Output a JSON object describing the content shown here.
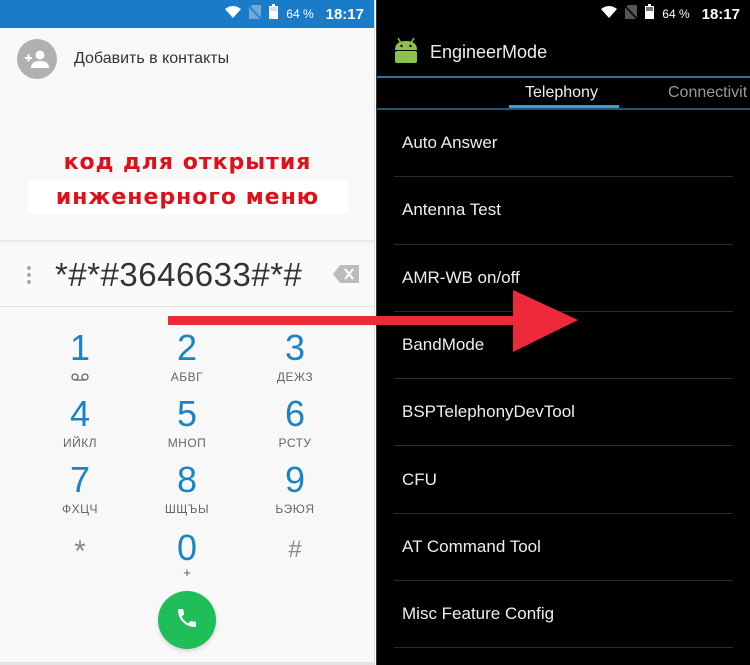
{
  "left_phone": {
    "statusbar": {
      "wifi_icon": "wifi-icon",
      "sim_icon": "no-sim-icon",
      "battery_icon": "battery-icon",
      "battery_percent": "64 %",
      "time": "18:17"
    },
    "add_contact": {
      "icon": "add-person-icon",
      "label": "Добавить в контакты"
    },
    "caption": {
      "line1": "код для открытия",
      "line2": "инженерного меню"
    },
    "dialer": {
      "number": "*#*#3646633#*#",
      "menu_icon": "overflow-menu-icon",
      "backspace_icon": "backspace-icon"
    },
    "keypad": [
      {
        "digit": "1",
        "sub": "voicemail-icon"
      },
      {
        "digit": "2",
        "sub": "АБВГ"
      },
      {
        "digit": "3",
        "sub": "ДЕЖЗ"
      },
      {
        "digit": "4",
        "sub": "ИЙКЛ"
      },
      {
        "digit": "5",
        "sub": "МНОП"
      },
      {
        "digit": "6",
        "sub": "РСТУ"
      },
      {
        "digit": "7",
        "sub": "ФХЦЧ"
      },
      {
        "digit": "8",
        "sub": "ШЩЪЫ"
      },
      {
        "digit": "9",
        "sub": "ЬЭЮЯ"
      },
      {
        "digit": "*",
        "sub": ""
      },
      {
        "digit": "0",
        "sub": "+"
      },
      {
        "digit": "#",
        "sub": ""
      }
    ],
    "call_button": {
      "icon": "phone-icon"
    }
  },
  "right_phone": {
    "statusbar": {
      "wifi_icon": "wifi-icon",
      "sim_icon": "no-sim-icon",
      "battery_icon": "battery-icon",
      "battery_percent": "64 %",
      "time": "18:17"
    },
    "app": {
      "icon": "android-icon",
      "title": "EngineerMode"
    },
    "tabs": [
      {
        "label": "Telephony",
        "active": true
      },
      {
        "label": "Connectivit",
        "active": false
      }
    ],
    "menu_items": [
      "Auto Answer",
      "Antenna Test",
      "AMR-WB on/off",
      "BandMode",
      "BSPTelephonyDevTool",
      "CFU",
      "AT Command Tool",
      "Misc Feature Config"
    ]
  },
  "overlay": {
    "arrow_color": "#ee2a3a",
    "caption_color": "#e0101a"
  },
  "colors": {
    "status_blue": "#1a7cc9",
    "key_blue": "#1a84c4",
    "call_green": "#1fbe58",
    "tab_accent": "#3a9fcf",
    "android_green": "#8bc34a"
  }
}
